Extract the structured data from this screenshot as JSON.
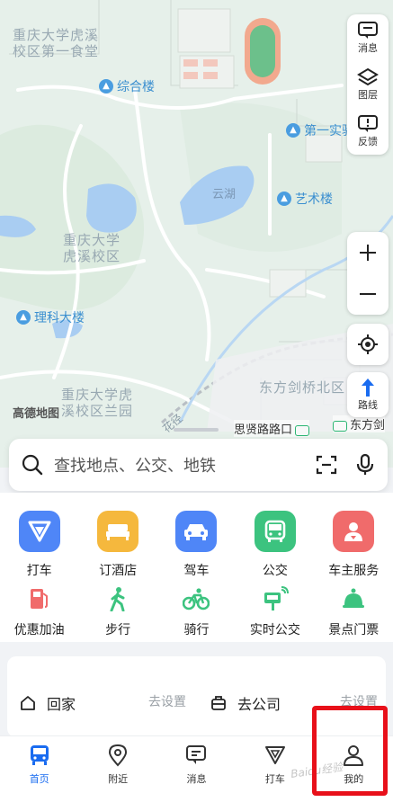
{
  "map": {
    "labels": {
      "cafeteria": "重庆大学虎溪\n校区第一食堂",
      "yunhu": "云湖",
      "campus": "重庆大学\n虎溪校区",
      "campus_lan": "重庆大学虎\n溪校区兰园",
      "dongfang": "东方剑桥北区",
      "road": "思贤路路口",
      "road2": "东方剑",
      "brand": "高德地图",
      "street": "花径"
    },
    "pois": {
      "zonghelou": "综合楼",
      "diyishi": "第一实验",
      "yishulou": "艺术楼",
      "like": "理科大楼"
    }
  },
  "controls": {
    "message": "消息",
    "layer": "图层",
    "feedback": "反馈",
    "route": "路线"
  },
  "search": {
    "placeholder": "查找地点、公交、地铁"
  },
  "services_row1": [
    {
      "label": "打车",
      "color": "#4f86f7"
    },
    {
      "label": "订酒店",
      "color": "#f5b83d"
    },
    {
      "label": "驾车",
      "color": "#4f86f7"
    },
    {
      "label": "公交",
      "color": "#3cc37f"
    },
    {
      "label": "车主服务",
      "color": "#f06b6b"
    }
  ],
  "services_row2": [
    {
      "label": "优惠加油"
    },
    {
      "label": "步行"
    },
    {
      "label": "骑行"
    },
    {
      "label": "实时公交"
    },
    {
      "label": "景点门票"
    }
  ],
  "shortcuts": {
    "home": "回家",
    "home_set": "去设置",
    "work": "去公司",
    "work_set": "去设置"
  },
  "nav": {
    "home": "首页",
    "nearby": "附近",
    "message": "消息",
    "taxi": "打车",
    "mine": "我的"
  },
  "watermark": "Baidu经验"
}
